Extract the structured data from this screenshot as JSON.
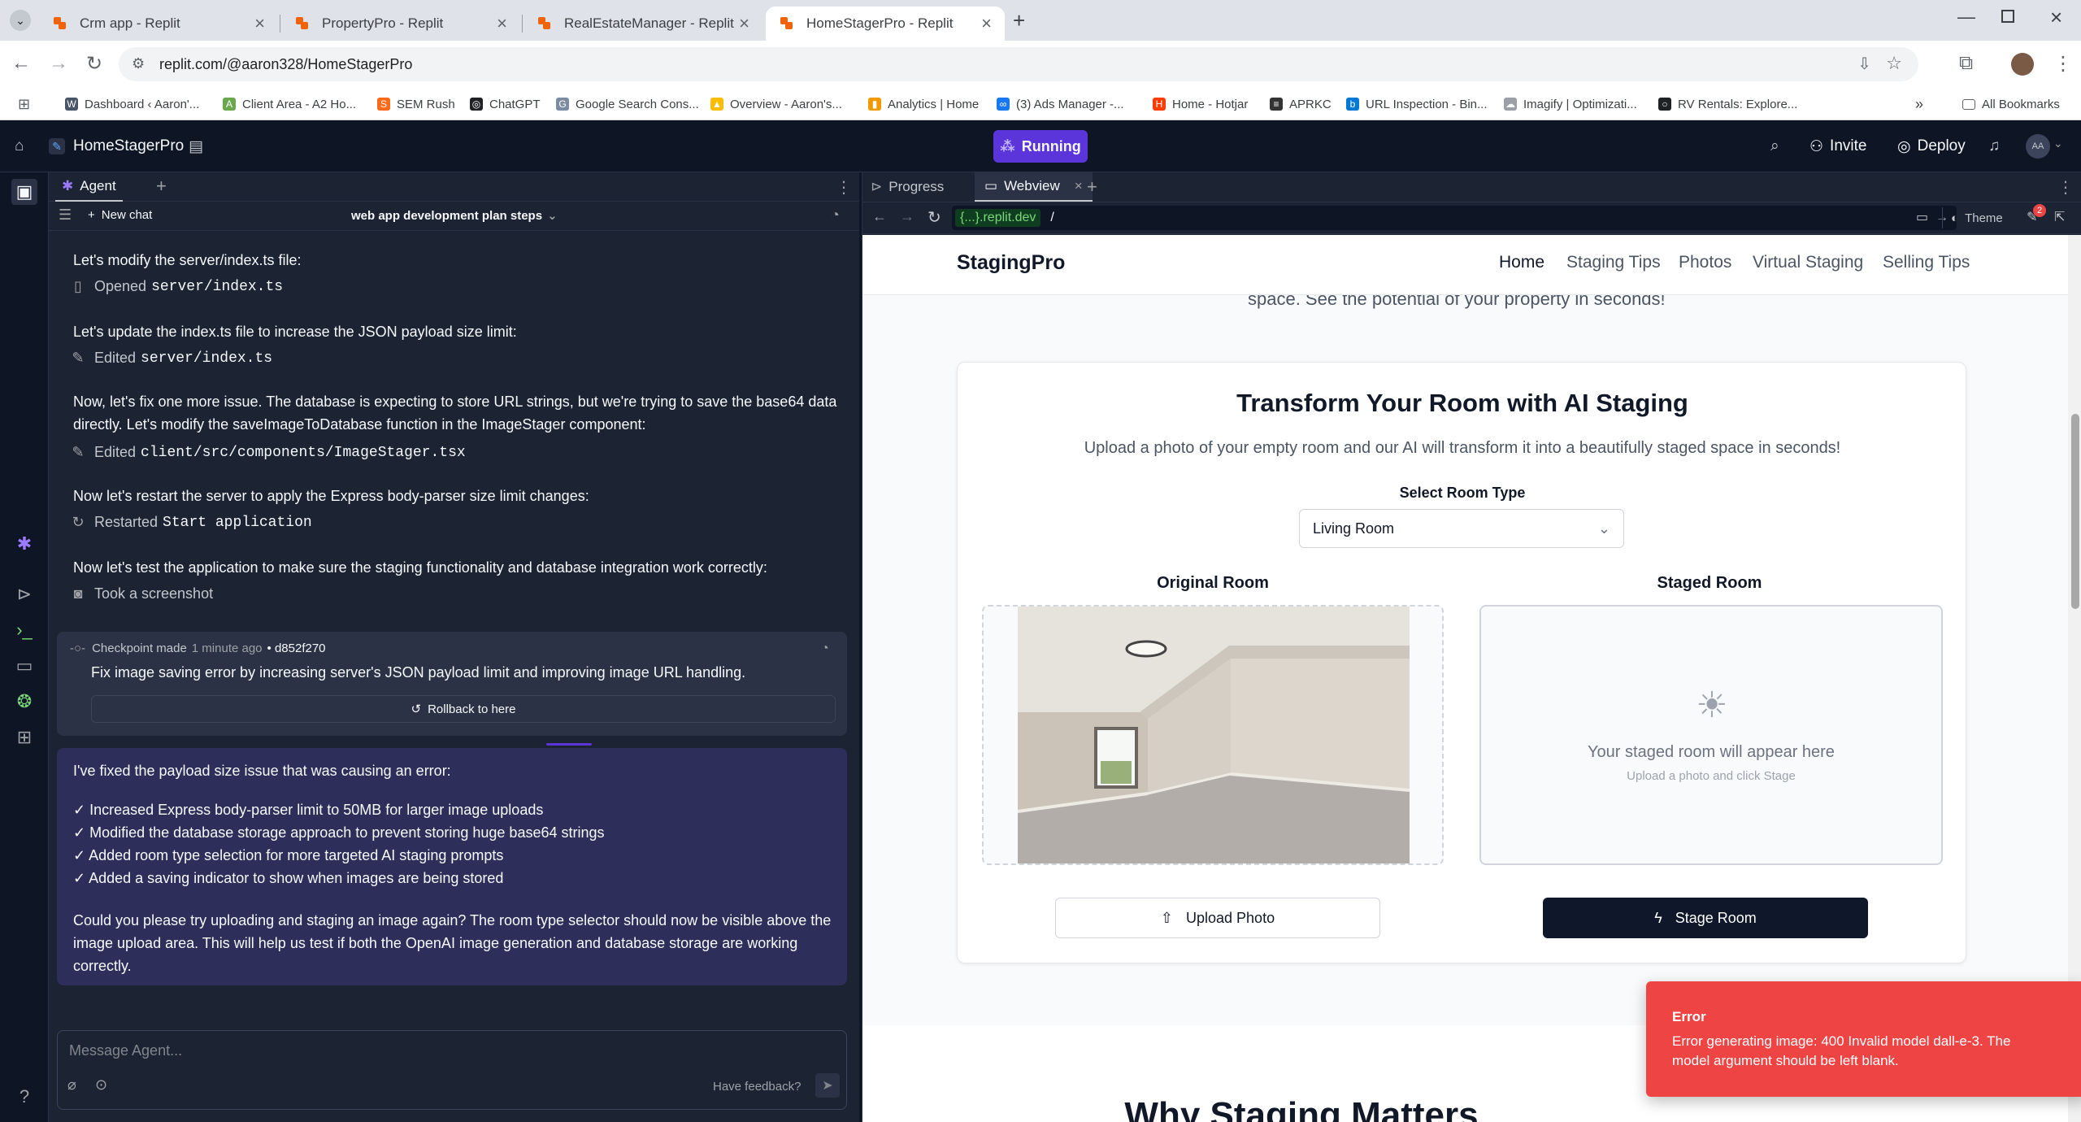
{
  "browser": {
    "tabs": [
      {
        "label": "Crm app - Replit"
      },
      {
        "label": "PropertyPro - Replit"
      },
      {
        "label": "RealEstateManager - Replit"
      },
      {
        "label": "HomeStagerPro - Replit",
        "active": true
      }
    ],
    "url": "replit.com/@aaron328/HomeStagerPro",
    "bookmarks": [
      "Dashboard ‹ Aaron'...",
      "Client Area - A2 Ho...",
      "SEM Rush",
      "ChatGPT",
      "Google Search Cons...",
      "Overview - Aaron's...",
      "Analytics | Home",
      "(3) Ads Manager -...",
      "Home - Hotjar",
      "APRKC",
      "URL Inspection - Bin...",
      "Imagify | Optimizati...",
      "RV Rentals: Explore..."
    ],
    "all_bookmarks": "All Bookmarks"
  },
  "replit": {
    "project_name": "HomeStagerPro",
    "run_status": "Running",
    "invite_label": "Invite",
    "deploy_label": "Deploy",
    "avatar_initials": "AA"
  },
  "agent": {
    "tab_label": "Agent",
    "new_chat_label": "New chat",
    "chat_title": "web app development plan steps",
    "messages": [
      {
        "text": "Let's modify the server/index.ts file:"
      },
      {
        "action": "Opened",
        "target": "server/index.ts"
      },
      {
        "text": "Let's update the index.ts file to increase the JSON payload size limit:"
      },
      {
        "action": "Edited",
        "target": "server/index.ts"
      },
      {
        "text": "Now, let's fix one more issue. The database is expecting to store URL strings, but we're trying to save the base64 data directly. Let's modify the saveImageToDatabase function in the ImageStager component:"
      },
      {
        "action": "Edited",
        "target": "client/src/components/ImageStager.tsx"
      },
      {
        "text": "Now let's restart the server to apply the Express body-parser size limit changes:"
      },
      {
        "action": "Restarted",
        "target": "Start application"
      },
      {
        "text": "Now let's test the application to make sure the staging functionality and database integration work correctly:"
      },
      {
        "action": "Took a screenshot",
        "target": ""
      }
    ],
    "checkpoint": {
      "label": "Checkpoint made",
      "time": "1 minute ago",
      "commit": "• d852f270",
      "description": "Fix image saving error by increasing server's JSON payload limit and improving image URL handling.",
      "rollback_label": "Rollback to here"
    },
    "summary": {
      "intro": "I've fixed the payload size issue that was causing an error:",
      "items": [
        "✓ Increased Express body-parser limit to 50MB for larger image uploads",
        "✓ Modified the database storage approach to prevent storing huge base64 strings",
        "✓ Added room type selection for more targeted AI staging prompts",
        "✓ Added a saving indicator to show when images are being stored"
      ],
      "closing": "Could you please try uploading and staging an image again? The room type selector should now be visible above the image upload area. This will help us test if both the OpenAI image generation and database storage are working correctly."
    },
    "input_placeholder": "Message Agent...",
    "feedback_label": "Have feedback?"
  },
  "right_panel": {
    "tabs": [
      {
        "label": "Progress"
      },
      {
        "label": "Webview",
        "active": true
      }
    ],
    "webview_domain": "{...}.replit.dev",
    "webview_path": "/",
    "theme_label": "Theme",
    "notif_count": "2"
  },
  "site": {
    "brand": "StagingPro",
    "nav": [
      "Home",
      "Staging Tips",
      "Photos",
      "Virtual Staging",
      "Selling Tips"
    ],
    "hero_fragment": "space. See the potential of your property in seconds!",
    "card_title": "Transform Your Room with AI Staging",
    "card_subtitle": "Upload a photo of your empty room and our AI will transform it into a beautifully staged space in seconds!",
    "room_type_label": "Select Room Type",
    "room_type_value": "Living Room",
    "original_label": "Original Room",
    "staged_label": "Staged Room",
    "staged_placeholder": "Your staged room will appear here",
    "staged_hint": "Upload a photo and click Stage",
    "upload_label": "Upload Photo",
    "stage_label": "Stage Room",
    "next_heading": "Why Staging Matters"
  },
  "toast": {
    "title": "Error",
    "message": "Error generating image: 400 Invalid model dall-e-3. The model argument should be left blank."
  },
  "colors": {
    "replit_bg": "#0e1525",
    "panel_bg": "#1c2333",
    "running": "#5b34da",
    "toast": "#ef4444",
    "stage_btn": "#0f172a"
  }
}
